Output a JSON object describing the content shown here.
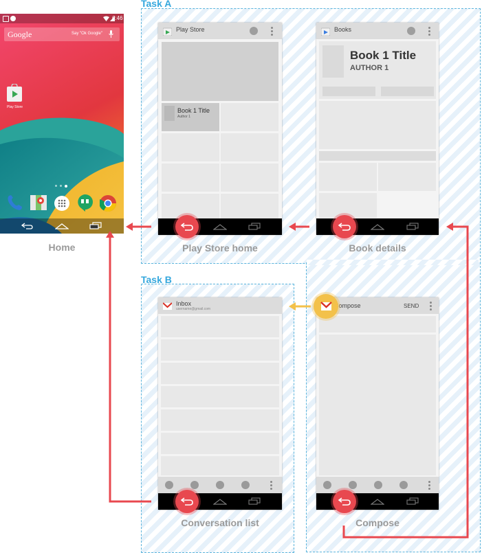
{
  "tasks": {
    "task_a": "Task A",
    "task_b": "Task B"
  },
  "home": {
    "caption": "Home",
    "status_time": "6:46",
    "search_brand": "Google",
    "search_hint": "Say \"Ok Google\"",
    "play_store_label": "Play Store"
  },
  "screens": {
    "play_store": {
      "caption": "Play Store home",
      "app_title": "Play Store",
      "card_title": "Book 1 Title",
      "card_author": "Author 1"
    },
    "book_details": {
      "caption": "Book details",
      "app_title": "Books",
      "book_title": "Book 1 Title",
      "book_author": "AUTHOR 1"
    },
    "conversation_list": {
      "caption": "Conversation list",
      "app_title": "Inbox",
      "account": "username@gmail.com"
    },
    "compose": {
      "caption": "Compose",
      "app_title": "Compose",
      "send_label": "SEND"
    }
  },
  "colors": {
    "back_arrow": "#e8484f",
    "up_arrow": "#f3c14a",
    "task_border": "#5ab4dc",
    "task_label": "#34a7dd"
  }
}
